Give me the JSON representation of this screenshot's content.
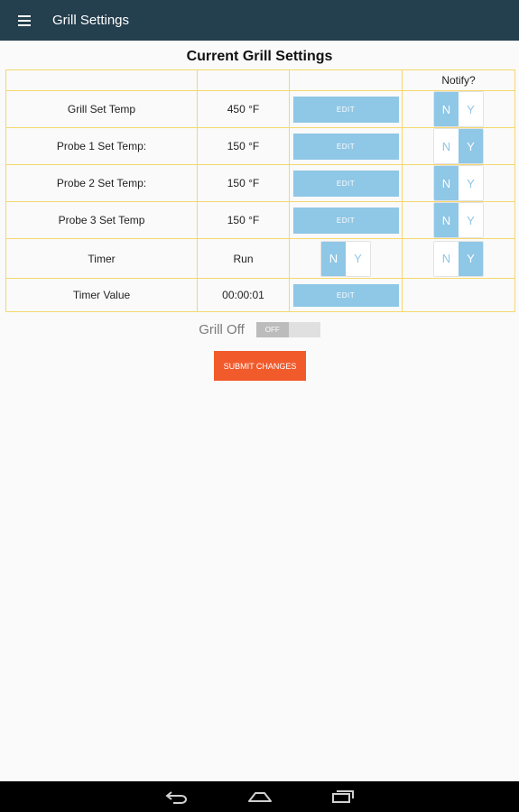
{
  "appbar": {
    "title": "Grill Settings",
    "menu_icon": "hamburger-menu-icon"
  },
  "page": {
    "heading": "Current Grill Settings"
  },
  "table": {
    "notify_header": "Notify?",
    "edit_label": "EDIT",
    "rows": [
      {
        "label": "Grill Set Temp",
        "value": "450 °F",
        "notify": "N"
      },
      {
        "label": "Probe 1 Set Temp:",
        "value": "150 °F",
        "notify": "Y"
      },
      {
        "label": "Probe 2 Set Temp:",
        "value": "150 °F",
        "notify": "N"
      },
      {
        "label": "Probe 3 Set Temp",
        "value": "150 °F",
        "notify": "N"
      }
    ],
    "timer": {
      "label": "Timer",
      "value": "Run",
      "run_toggle": "N",
      "notify": "Y"
    },
    "timer_value": {
      "label": "Timer Value",
      "value": "00:00:01"
    },
    "toggle_options": {
      "no": "N",
      "yes": "Y"
    }
  },
  "grill_off": {
    "label": "Grill Off",
    "switch_text": "OFF",
    "state": "off"
  },
  "submit": {
    "label": "SUBMIT CHANGES"
  },
  "navbar": {
    "back_icon": "back-icon",
    "home_icon": "home-icon",
    "recents_icon": "recent-apps-icon"
  },
  "colors": {
    "appbar": "#243f4e",
    "accent_blue": "#8fc7e6",
    "table_border": "#f5d76e",
    "submit": "#f15a2b"
  }
}
